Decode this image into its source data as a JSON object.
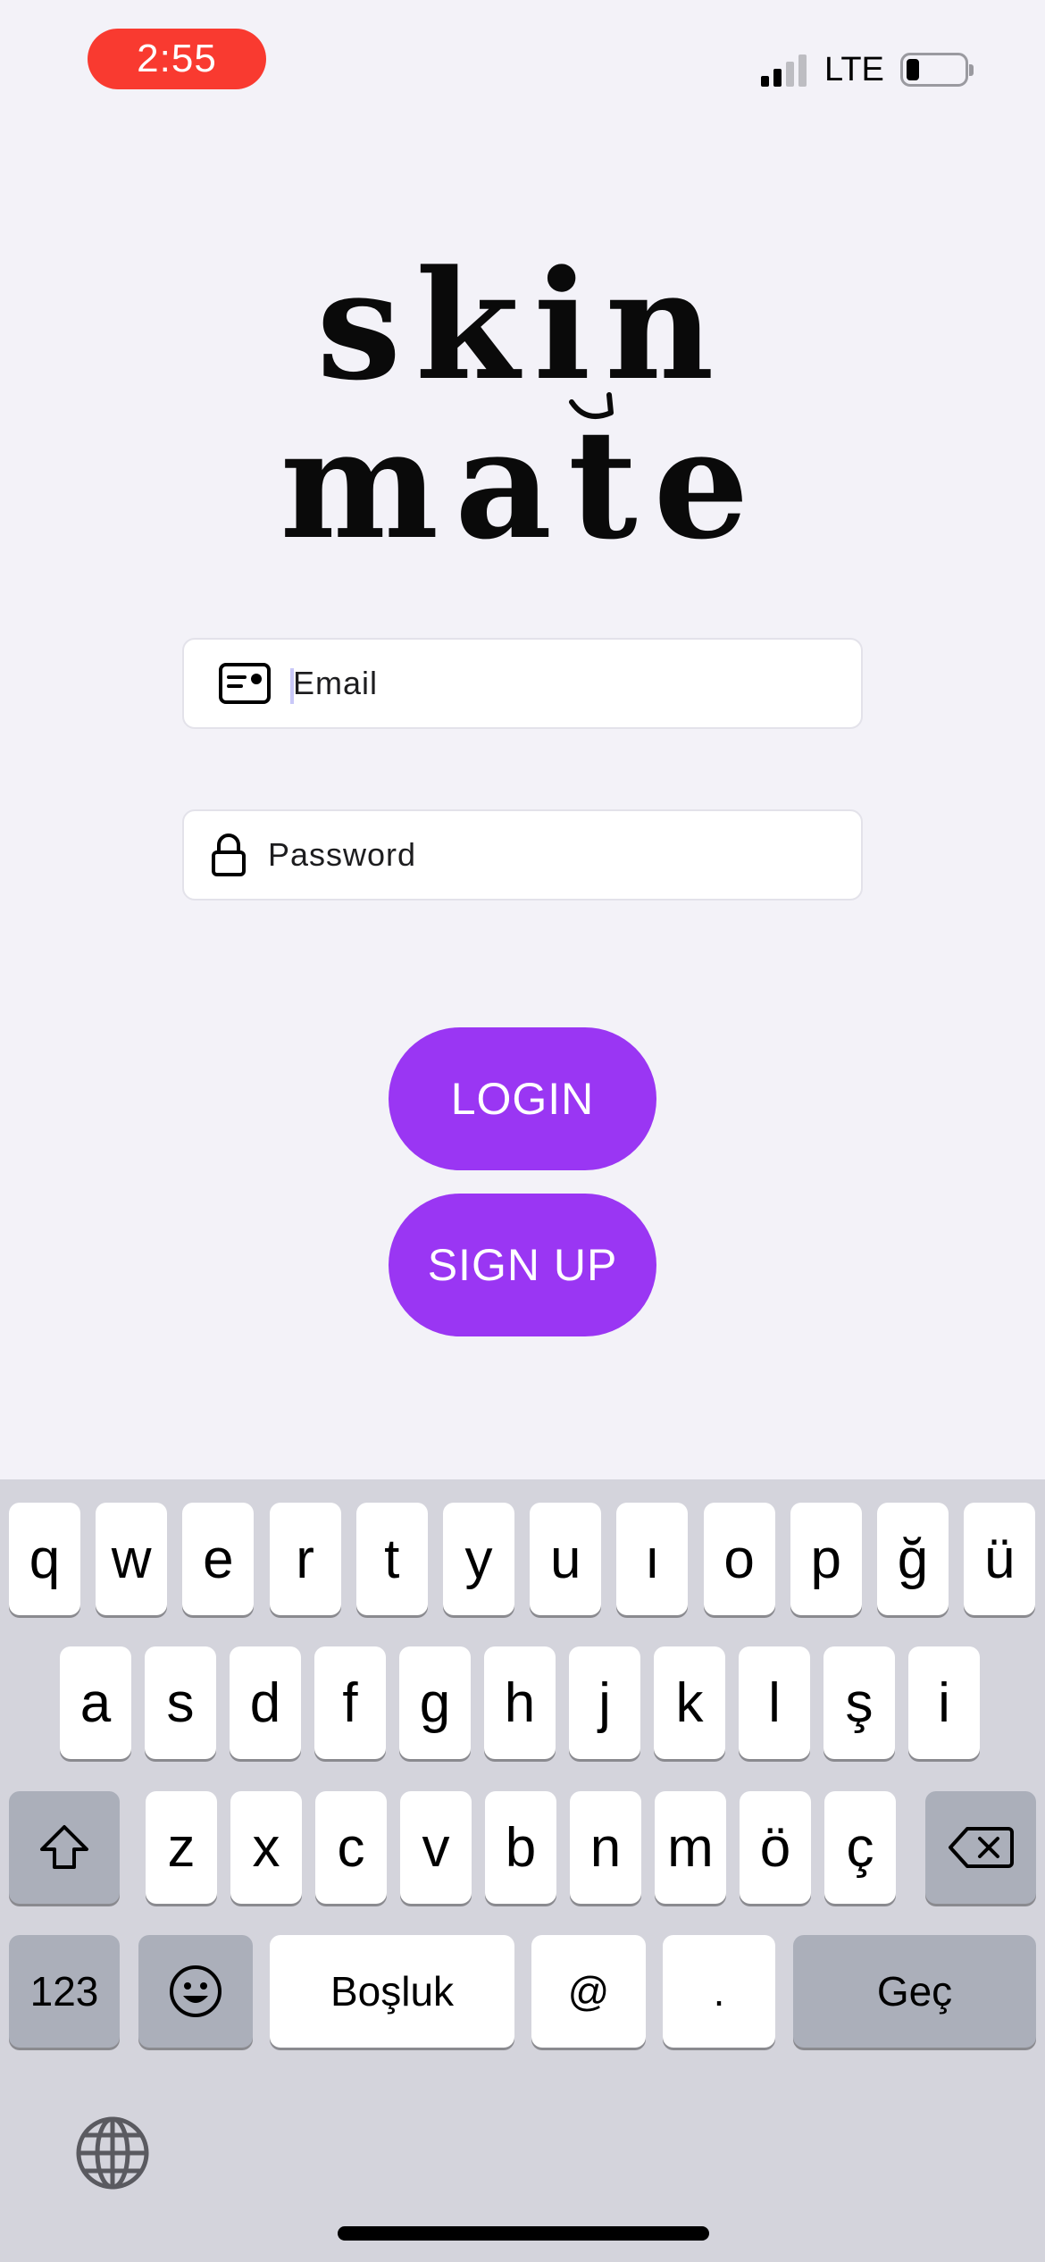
{
  "status_bar": {
    "time": "2:55",
    "network": "LTE",
    "battery_level": 0.2,
    "signal_bars_active": 2,
    "signal_bars_total": 4
  },
  "logo": {
    "line1": "skin",
    "line2": "mate"
  },
  "form": {
    "email_placeholder": "Email",
    "password_placeholder": "Password"
  },
  "buttons": {
    "login": "LOGIN",
    "signup": "SIGN UP"
  },
  "keyboard": {
    "row1": [
      "q",
      "w",
      "e",
      "r",
      "t",
      "y",
      "u",
      "ı",
      "o",
      "p",
      "ğ",
      "ü"
    ],
    "row2": [
      "a",
      "s",
      "d",
      "f",
      "g",
      "h",
      "j",
      "k",
      "l",
      "ş",
      "i"
    ],
    "row3": [
      "z",
      "x",
      "c",
      "v",
      "b",
      "n",
      "m",
      "ö",
      "ç"
    ],
    "numbers_label": "123",
    "space_label": "Boşluk",
    "at_label": "@",
    "period_label": ".",
    "return_label": "Geç"
  },
  "colors": {
    "accent": "#9a36f3",
    "background": "#f3f2f8",
    "status_time_bg": "#f93a30",
    "keyboard_bg": "#d4d4dc"
  },
  "icons": [
    "id-card-icon",
    "lock-icon",
    "shift-icon",
    "delete-icon",
    "emoji-icon",
    "globe-icon"
  ]
}
